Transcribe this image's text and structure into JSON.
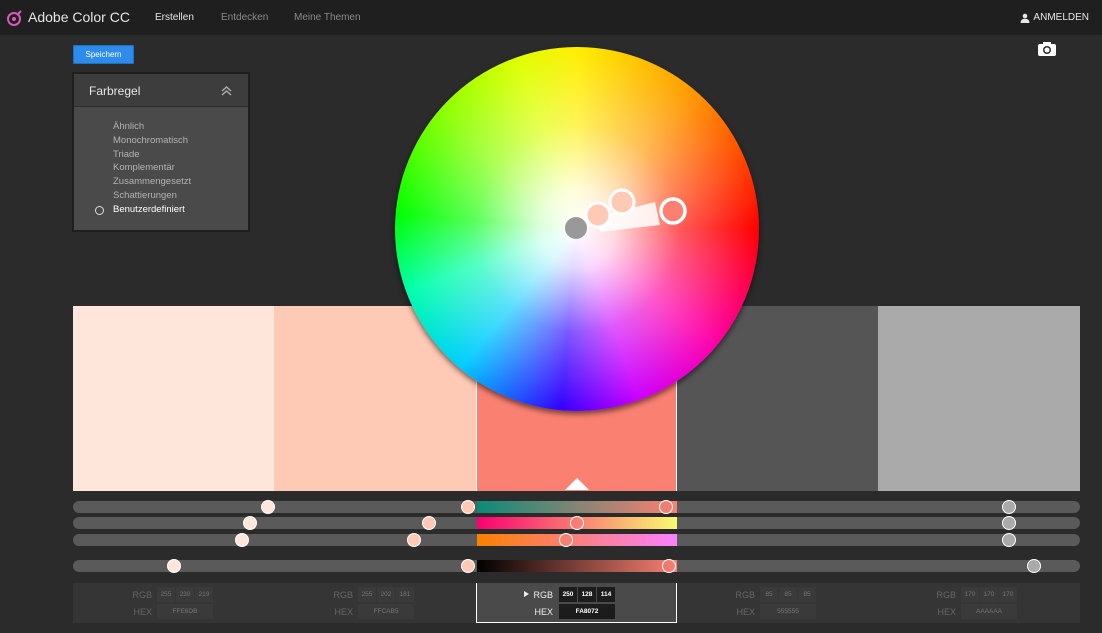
{
  "app": {
    "title": "Adobe Color CC",
    "nav": [
      "Erstellen",
      "Entdecken",
      "Meine Themen"
    ],
    "active_nav": "Erstellen",
    "login_label": "ANMELDEN"
  },
  "toolbar": {
    "save_label": "Speichern",
    "camera_icon": "camera-icon"
  },
  "rule_panel": {
    "title": "Farbregel",
    "items": [
      "Ähnlich",
      "Monochromatisch",
      "Triade",
      "Komplementär",
      "Zusammengesetzt",
      "Schattierungen",
      "Benutzerdefiniert"
    ],
    "selected": "Benutzerdefiniert"
  },
  "swatches": [
    {
      "hex_color": "#FFE6DB",
      "rgb": [
        "255",
        "230",
        "219"
      ],
      "hex": "FFE6DB"
    },
    {
      "hex_color": "#FFCAB5",
      "rgb": [
        "255",
        "202",
        "181"
      ],
      "hex": "FFCAB5"
    },
    {
      "hex_color": "#FA8072",
      "rgb": [
        "250",
        "128",
        "114"
      ],
      "hex": "FA8072",
      "selected": true
    },
    {
      "hex_color": "#555555",
      "rgb": [
        "85",
        "85",
        "85"
      ],
      "hex": "555555"
    },
    {
      "hex_color": "#AAAAAA",
      "rgb": [
        "170",
        "170",
        "170"
      ],
      "hex": "AAAAAA"
    }
  ],
  "labels": {
    "rgb": "RGB",
    "hex": "HEX"
  },
  "colors": {
    "accent": "#2D8CEB",
    "background": "#2B2B2B",
    "topbar": "#1F1F1F"
  }
}
